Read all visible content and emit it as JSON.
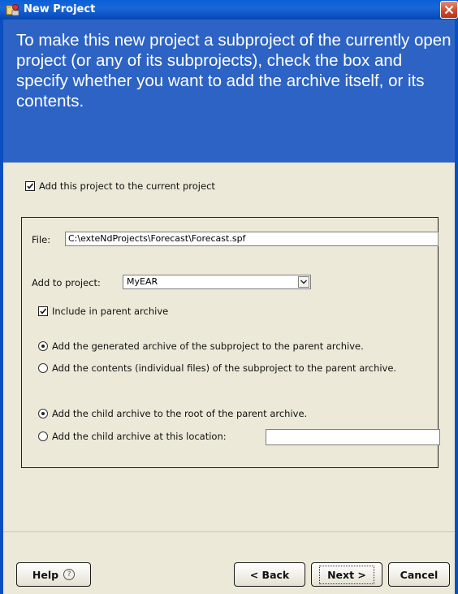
{
  "window": {
    "title": "New Project"
  },
  "banner": {
    "text": "To make this new project a subproject of the currently open project (or any of its subprojects), check the box and specify whether you want to add the archive itself, or its contents."
  },
  "add_to_current": {
    "label": "Add this project to the current project",
    "checked": true
  },
  "file": {
    "label": "File:",
    "value": "C:\\exteNdProjects\\Forecast\\Forecast.spf"
  },
  "add_to_project": {
    "label": "Add to project:",
    "selected": "MyEAR"
  },
  "include_parent": {
    "label": "Include in parent archive",
    "checked": true
  },
  "archive_mode": {
    "options": [
      {
        "label": "Add the generated archive of the subproject to the parent archive.",
        "selected": true
      },
      {
        "label": "Add the contents (individual files) of the subproject to the parent archive.",
        "selected": false
      }
    ]
  },
  "location_mode": {
    "options": [
      {
        "label": "Add the child archive to the root of the parent archive.",
        "selected": true
      },
      {
        "label": "Add the child archive at this location:",
        "selected": false
      }
    ],
    "location_value": ""
  },
  "buttons": {
    "help": "Help",
    "help_icon": "?",
    "back": "< Back",
    "next": "Next >",
    "cancel": "Cancel"
  },
  "colors": {
    "banner": "#2d63c4",
    "titlebar": "#0a5fd8",
    "dialog_bg": "#ece9d8"
  }
}
